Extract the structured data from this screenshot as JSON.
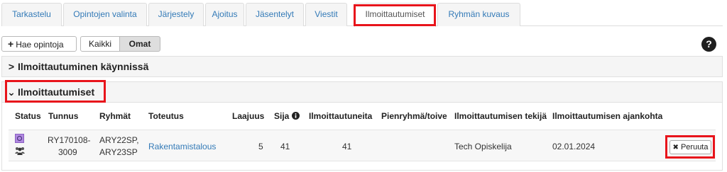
{
  "tabs": [
    {
      "label": "Tarkastelu",
      "active": false
    },
    {
      "label": "Opintojen valinta",
      "active": false
    },
    {
      "label": "Järjestely",
      "active": false
    },
    {
      "label": "Ajoitus",
      "active": false
    },
    {
      "label": "Jäsentelyt",
      "active": false
    },
    {
      "label": "Viestit",
      "active": false
    },
    {
      "label": "Ilmoittautumiset",
      "active": true
    },
    {
      "label": "Ryhmän kuvaus",
      "active": false
    }
  ],
  "toolbar": {
    "search_courses": "Hae opintoja",
    "filter_all": "Kaikki",
    "filter_own": "Omat",
    "help": "?"
  },
  "panels": {
    "in_progress": "Ilmoittautuminen käynnissä",
    "enrollments": "Ilmoittautumiset"
  },
  "table": {
    "headers": {
      "status": "Status",
      "code": "Tunnus",
      "groups": "Ryhmät",
      "implementation": "Toteutus",
      "scope": "Laajuus",
      "position": "Sija",
      "enrolled": "Ilmoittautuneita",
      "subgroup": "Pienryhmä/toive",
      "enroller": "Ilmoittautumisen tekijä",
      "time": "Ilmoittautumisen ajankohta"
    },
    "rows": [
      {
        "code_line1": "RY170108-",
        "code_line2": "3009",
        "groups_line1": "ARY22SP,",
        "groups_line2": "ARY23SP",
        "implementation": "Rakentamistalous",
        "scope": "5",
        "position": "41",
        "enrolled": "41",
        "subgroup": "",
        "enroller": "Tech Opiskelija",
        "time": "02.01.2024",
        "action": "Peruuta"
      }
    ]
  },
  "colors": {
    "highlight": "#e8141b",
    "link": "#337ab7",
    "status": "#b189e0"
  }
}
